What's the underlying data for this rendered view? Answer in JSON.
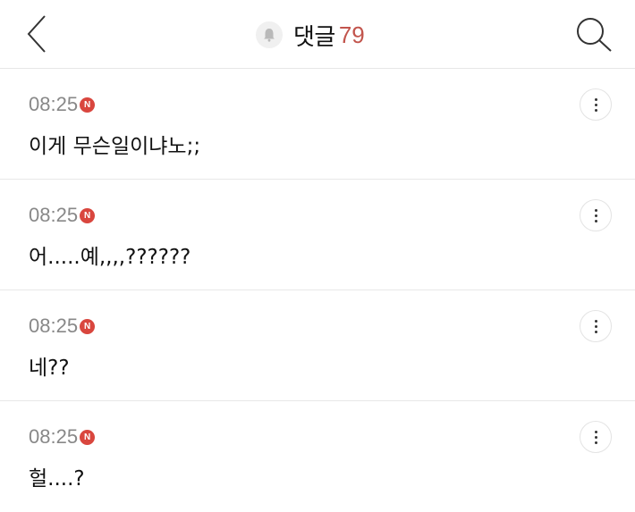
{
  "header": {
    "title": "댓글",
    "count": "79",
    "back_icon": "chevron-left-icon",
    "search_icon": "search-icon",
    "bell_icon": "bell-icon"
  },
  "comments": [
    {
      "time": "08:25",
      "badge": "N",
      "text": "이게 무슨일이냐노;;"
    },
    {
      "time": "08:25",
      "badge": "N",
      "text": "어.....예,,,,??????"
    },
    {
      "time": "08:25",
      "badge": "N",
      "text": "네??"
    },
    {
      "time": "08:25",
      "badge": "N",
      "text": "헐....?"
    }
  ],
  "colors": {
    "accent": "#c2554d",
    "badge": "#d9463e",
    "muted": "#888888"
  }
}
